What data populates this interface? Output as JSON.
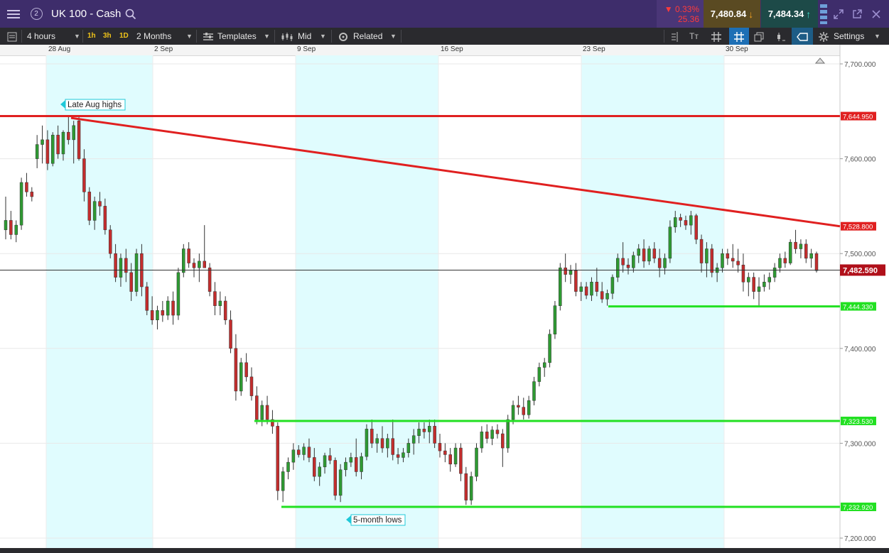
{
  "header": {
    "menu_icon": "hamburger-menu-icon",
    "badge": "2",
    "title": "UK 100 - Cash",
    "search_icon": "search-icon",
    "change_pct": "▼ 0.33%",
    "change_pts": "25.36",
    "sell_price": "7,480.84",
    "buy_price": "7,484.34"
  },
  "toolbar": {
    "interval": "4 hours",
    "tf_1h": "1h",
    "tf_3h": "3h",
    "tf_1d": "1D",
    "range": "2 Months",
    "templates": "Templates",
    "price_mode": "Mid",
    "related": "Related",
    "settings": "Settings"
  },
  "colors": {
    "header_bg": "#3e2d6b",
    "sell_box": "#5a4a22",
    "buy_box": "#1d4a48",
    "up_candle": "#2e9a32",
    "down_candle": "#c32d2d",
    "resistance": "#e02020",
    "support": "#22e022",
    "shade": "#e0fcfe"
  },
  "dates": [
    "28 Aug",
    "2 Sep",
    "9 Sep",
    "16 Sep",
    "23 Sep",
    "30 Sep"
  ],
  "chart_data": {
    "type": "candlestick",
    "symbol": "UK 100 - Cash",
    "interval": "4 hours",
    "ylim": [
      7200,
      7700
    ],
    "y_ticks": [
      "7,700.000",
      "7,600.000",
      "7,500.000",
      "7,400.000",
      "7,300.000",
      "7,200.000"
    ],
    "horizontal_levels": [
      {
        "label": "7,644.950",
        "value": 7644.95,
        "color": "#e02020"
      },
      {
        "label": "7,444.330",
        "value": 7444.33,
        "color": "#22e022"
      },
      {
        "label": "7,323.530",
        "value": 7323.53,
        "color": "#22e022"
      },
      {
        "label": "7,232.920",
        "value": 7232.92,
        "color": "#22e022"
      }
    ],
    "trendline": {
      "label": "7,528.800",
      "start_value": 7643,
      "end_value": 7528.8,
      "color": "#e02020"
    },
    "current": {
      "label": "7,482.590",
      "value": 7482.59
    },
    "annotations": [
      "Late Aug highs",
      "5-month lows"
    ],
    "candles": [
      [
        7525,
        7560,
        7515,
        7535
      ],
      [
        7535,
        7545,
        7515,
        7520
      ],
      [
        7520,
        7535,
        7512,
        7530
      ],
      [
        7530,
        7580,
        7525,
        7575
      ],
      [
        7575,
        7585,
        7560,
        7565
      ],
      [
        7565,
        7570,
        7555,
        7560
      ],
      [
        7600,
        7625,
        7590,
        7615
      ],
      [
        7615,
        7635,
        7595,
        7620
      ],
      [
        7620,
        7630,
        7588,
        7595
      ],
      [
        7595,
        7628,
        7592,
        7625
      ],
      [
        7625,
        7635,
        7600,
        7605
      ],
      [
        7605,
        7630,
        7598,
        7628
      ],
      [
        7628,
        7645,
        7615,
        7620
      ],
      [
        7620,
        7640,
        7595,
        7635
      ],
      [
        7640,
        7645,
        7598,
        7600
      ],
      [
        7600,
        7610,
        7555,
        7565
      ],
      [
        7565,
        7570,
        7530,
        7535
      ],
      [
        7535,
        7560,
        7525,
        7555
      ],
      [
        7555,
        7565,
        7540,
        7550
      ],
      [
        7550,
        7558,
        7520,
        7525
      ],
      [
        7525,
        7530,
        7495,
        7500
      ],
      [
        7500,
        7510,
        7470,
        7475
      ],
      [
        7475,
        7500,
        7465,
        7495
      ],
      [
        7495,
        7505,
        7470,
        7480
      ],
      [
        7480,
        7490,
        7450,
        7460
      ],
      [
        7460,
        7505,
        7455,
        7500
      ],
      [
        7500,
        7510,
        7455,
        7465
      ],
      [
        7465,
        7470,
        7435,
        7440
      ],
      [
        7440,
        7455,
        7425,
        7430
      ],
      [
        7430,
        7445,
        7420,
        7440
      ],
      [
        7440,
        7450,
        7428,
        7435
      ],
      [
        7435,
        7455,
        7430,
        7450
      ],
      [
        7450,
        7460,
        7425,
        7435
      ],
      [
        7435,
        7485,
        7430,
        7480
      ],
      [
        7480,
        7510,
        7475,
        7505
      ],
      [
        7505,
        7512,
        7485,
        7490
      ],
      [
        7490,
        7495,
        7475,
        7485
      ],
      [
        7485,
        7500,
        7470,
        7492
      ],
      [
        7492,
        7530,
        7485,
        7485
      ],
      [
        7485,
        7490,
        7455,
        7460
      ],
      [
        7460,
        7470,
        7435,
        7445
      ],
      [
        7445,
        7460,
        7435,
        7450
      ],
      [
        7450,
        7455,
        7425,
        7430
      ],
      [
        7430,
        7440,
        7395,
        7400
      ],
      [
        7400,
        7415,
        7345,
        7355
      ],
      [
        7355,
        7390,
        7350,
        7385
      ],
      [
        7385,
        7395,
        7365,
        7370
      ],
      [
        7370,
        7380,
        7345,
        7350
      ],
      [
        7350,
        7360,
        7320,
        7325
      ],
      [
        7325,
        7345,
        7318,
        7340
      ],
      [
        7340,
        7350,
        7320,
        7325
      ],
      [
        7325,
        7335,
        7310,
        7318
      ],
      [
        7318,
        7322,
        7240,
        7250
      ],
      [
        7250,
        7275,
        7238,
        7270
      ],
      [
        7270,
        7285,
        7262,
        7280
      ],
      [
        7280,
        7300,
        7272,
        7293
      ],
      [
        7293,
        7298,
        7285,
        7288
      ],
      [
        7288,
        7300,
        7282,
        7296
      ],
      [
        7296,
        7305,
        7280,
        7285
      ],
      [
        7285,
        7295,
        7260,
        7265
      ],
      [
        7265,
        7280,
        7255,
        7275
      ],
      [
        7275,
        7290,
        7268,
        7287
      ],
      [
        7287,
        7295,
        7278,
        7282
      ],
      [
        7282,
        7285,
        7240,
        7245
      ],
      [
        7245,
        7278,
        7238,
        7272
      ],
      [
        7272,
        7285,
        7265,
        7280
      ],
      [
        7280,
        7290,
        7275,
        7285
      ],
      [
        7285,
        7305,
        7265,
        7270
      ],
      [
        7270,
        7290,
        7262,
        7286
      ],
      [
        7286,
        7320,
        7282,
        7315
      ],
      [
        7315,
        7325,
        7295,
        7300
      ],
      [
        7300,
        7310,
        7290,
        7305
      ],
      [
        7305,
        7318,
        7290,
        7295
      ],
      [
        7295,
        7310,
        7285,
        7305
      ],
      [
        7305,
        7325,
        7282,
        7288
      ],
      [
        7288,
        7295,
        7278,
        7285
      ],
      [
        7285,
        7295,
        7280,
        7290
      ],
      [
        7290,
        7305,
        7285,
        7300
      ],
      [
        7300,
        7315,
        7288,
        7308
      ],
      [
        7308,
        7322,
        7300,
        7315
      ],
      [
        7315,
        7322,
        7305,
        7312
      ],
      [
        7312,
        7325,
        7300,
        7318
      ],
      [
        7318,
        7325,
        7295,
        7300
      ],
      [
        7300,
        7310,
        7285,
        7292
      ],
      [
        7292,
        7300,
        7280,
        7288
      ],
      [
        7288,
        7295,
        7270,
        7278
      ],
      [
        7278,
        7300,
        7275,
        7295
      ],
      [
        7295,
        7300,
        7260,
        7268
      ],
      [
        7268,
        7275,
        7235,
        7240
      ],
      [
        7240,
        7270,
        7235,
        7265
      ],
      [
        7265,
        7300,
        7260,
        7295
      ],
      [
        7295,
        7318,
        7290,
        7312
      ],
      [
        7312,
        7320,
        7300,
        7305
      ],
      [
        7305,
        7318,
        7298,
        7314
      ],
      [
        7314,
        7320,
        7305,
        7310
      ],
      [
        7310,
        7315,
        7275,
        7295
      ],
      [
        7295,
        7330,
        7290,
        7325
      ],
      [
        7325,
        7345,
        7320,
        7340
      ],
      [
        7340,
        7350,
        7330,
        7338
      ],
      [
        7338,
        7348,
        7325,
        7330
      ],
      [
        7330,
        7350,
        7326,
        7345
      ],
      [
        7345,
        7370,
        7340,
        7365
      ],
      [
        7365,
        7385,
        7360,
        7380
      ],
      [
        7380,
        7390,
        7370,
        7385
      ],
      [
        7385,
        7420,
        7380,
        7415
      ],
      [
        7415,
        7450,
        7410,
        7445
      ],
      [
        7445,
        7490,
        7440,
        7485
      ],
      [
        7485,
        7500,
        7470,
        7478
      ],
      [
        7478,
        7488,
        7468,
        7482
      ],
      [
        7482,
        7490,
        7455,
        7460
      ],
      [
        7460,
        7470,
        7450,
        7465
      ],
      [
        7465,
        7470,
        7452,
        7456
      ],
      [
        7456,
        7475,
        7450,
        7470
      ],
      [
        7470,
        7485,
        7455,
        7460
      ],
      [
        7460,
        7470,
        7448,
        7452
      ],
      [
        7452,
        7462,
        7445,
        7458
      ],
      [
        7458,
        7478,
        7452,
        7475
      ],
      [
        7475,
        7500,
        7470,
        7495
      ],
      [
        7495,
        7512,
        7480,
        7488
      ],
      [
        7488,
        7495,
        7478,
        7485
      ],
      [
        7485,
        7502,
        7480,
        7498
      ],
      [
        7498,
        7510,
        7490,
        7505
      ],
      [
        7505,
        7515,
        7485,
        7492
      ],
      [
        7492,
        7508,
        7488,
        7505
      ],
      [
        7505,
        7512,
        7490,
        7495
      ],
      [
        7495,
        7505,
        7475,
        7485
      ],
      [
        7485,
        7500,
        7478,
        7495
      ],
      [
        7495,
        7535,
        7490,
        7528
      ],
      [
        7528,
        7545,
        7522,
        7538
      ],
      [
        7538,
        7542,
        7528,
        7535
      ],
      [
        7535,
        7540,
        7525,
        7530
      ],
      [
        7530,
        7545,
        7520,
        7540
      ],
      [
        7540,
        7542,
        7510,
        7515
      ],
      [
        7515,
        7520,
        7480,
        7490
      ],
      [
        7490,
        7512,
        7475,
        7505
      ],
      [
        7505,
        7510,
        7475,
        7480
      ],
      [
        7480,
        7490,
        7470,
        7485
      ],
      [
        7485,
        7505,
        7480,
        7500
      ],
      [
        7500,
        7505,
        7488,
        7495
      ],
      [
        7495,
        7510,
        7485,
        7492
      ],
      [
        7492,
        7505,
        7480,
        7488
      ],
      [
        7488,
        7500,
        7460,
        7470
      ],
      [
        7470,
        7480,
        7455,
        7475
      ],
      [
        7475,
        7480,
        7452,
        7460
      ],
      [
        7460,
        7475,
        7445,
        7465
      ],
      [
        7465,
        7478,
        7460,
        7470
      ],
      [
        7470,
        7480,
        7462,
        7475
      ],
      [
        7475,
        7490,
        7470,
        7485
      ],
      [
        7485,
        7500,
        7480,
        7495
      ],
      [
        7495,
        7502,
        7485,
        7490
      ],
      [
        7490,
        7515,
        7488,
        7512
      ],
      [
        7512,
        7525,
        7500,
        7505
      ],
      [
        7505,
        7515,
        7495,
        7510
      ],
      [
        7510,
        7515,
        7490,
        7495
      ],
      [
        7495,
        7505,
        7485,
        7500
      ],
      [
        7500,
        7502,
        7480,
        7482
      ]
    ]
  }
}
